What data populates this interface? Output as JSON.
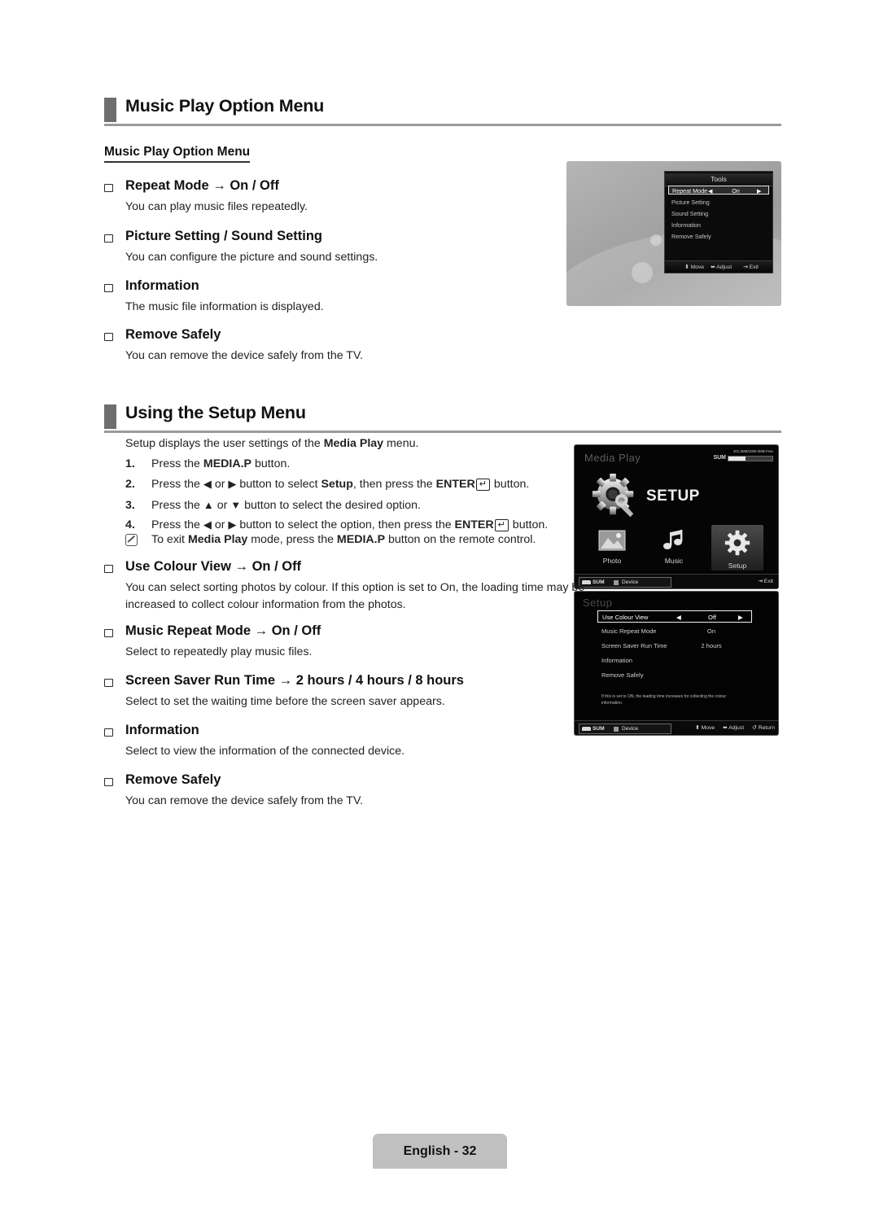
{
  "page": {
    "footer_label": "English - 32"
  },
  "section1": {
    "heading": "Music Play Option Menu",
    "subheading": "Music Play Option Menu",
    "items": [
      {
        "title": "Repeat Mode → On / Off",
        "desc": "You can play music files repeatedly."
      },
      {
        "title": "Picture Setting / Sound Setting",
        "desc": "You can configure the picture and sound settings."
      },
      {
        "title": "Information",
        "desc": "The music file information is displayed."
      },
      {
        "title": "Remove Safely",
        "desc": "You can remove the device safely from the TV."
      }
    ]
  },
  "section2": {
    "heading": "Using the Setup Menu",
    "intro_a": "Setup displays the user settings of the ",
    "intro_b": "Media Play",
    "intro_c": " menu.",
    "steps": [
      {
        "num": "1.",
        "text": "Press the MEDIA.P button."
      },
      {
        "num": "2.",
        "text": "Press the ◀ or ▶ button to select Setup, then press the ENTER button."
      },
      {
        "num": "3.",
        "text": "Press the ▲ or ▼ button to select the desired option."
      },
      {
        "num": "4.",
        "text": "Press the ◀ or ▶ button to select the option, then press the ENTER button."
      }
    ],
    "note": "To exit Media Play mode, press the MEDIA.P button on the remote control.",
    "items": [
      {
        "title": "Use Colour View → On / Off",
        "desc": "You can select sorting photos by colour. If this option is set to On, the loading time may be increased to collect colour information from the photos."
      },
      {
        "title": "Music Repeat Mode → On / Off",
        "desc": "Select to repeatedly play music files."
      },
      {
        "title": "Screen Saver Run Time → 2 hours / 4 hours / 8 hours",
        "desc": "Select to set the waiting time before the screen saver appears."
      },
      {
        "title": "Information",
        "desc": "Select to view the information of the connected device."
      },
      {
        "title": "Remove Safely",
        "desc": "You can remove the device safely from the TV."
      }
    ]
  },
  "tools_screen": {
    "title": "Tools",
    "rows": [
      {
        "label": "Repeat Mode",
        "value": "On",
        "selected": true
      },
      {
        "label": "Picture Setting",
        "value": "",
        "selected": false
      },
      {
        "label": "Sound Setting",
        "value": "",
        "selected": false
      },
      {
        "label": "Information",
        "value": "",
        "selected": false
      },
      {
        "label": "Remove Safely",
        "value": "",
        "selected": false
      }
    ],
    "footer": {
      "move": "Move",
      "adjust": "Adjust",
      "exit": "Exit"
    },
    "arrow_left": "◀",
    "arrow_right": "▶"
  },
  "media_screen": {
    "title": "Media Play",
    "sum_label": "SUM",
    "sum_info": "201.2MB/1000.0MB Free",
    "hero_label": "SETUP",
    "tiles": [
      {
        "label": "Photo",
        "active": false
      },
      {
        "label": "Music",
        "active": false
      },
      {
        "label": "Setup",
        "active": true
      }
    ],
    "footer": {
      "sum": "SUM",
      "device": "Device",
      "exit": "Exit"
    }
  },
  "setup_screen": {
    "title": "Setup",
    "rows": [
      {
        "label": "Use Colour View",
        "value": "Off",
        "selected": true
      },
      {
        "label": "Music Repeat Mode",
        "value": "On",
        "selected": false
      },
      {
        "label": "Screen Saver Run Time",
        "value": "2 hours",
        "selected": false
      },
      {
        "label": "Information",
        "value": "",
        "selected": false
      },
      {
        "label": "Remove Safely",
        "value": "",
        "selected": false
      }
    ],
    "help": "If this is set to ON, the loading time increases for collecting the colour information.",
    "footer": {
      "sum": "SUM",
      "device": "Device",
      "move": "Move",
      "adjust": "Adjust",
      "return": "Return"
    },
    "arrow_left": "◀",
    "arrow_right": "▶"
  },
  "glyphs": {
    "move_icon": "⬍",
    "adjust_icon": "⬌",
    "return_icon": "↺",
    "exit_icon": "⇥"
  }
}
